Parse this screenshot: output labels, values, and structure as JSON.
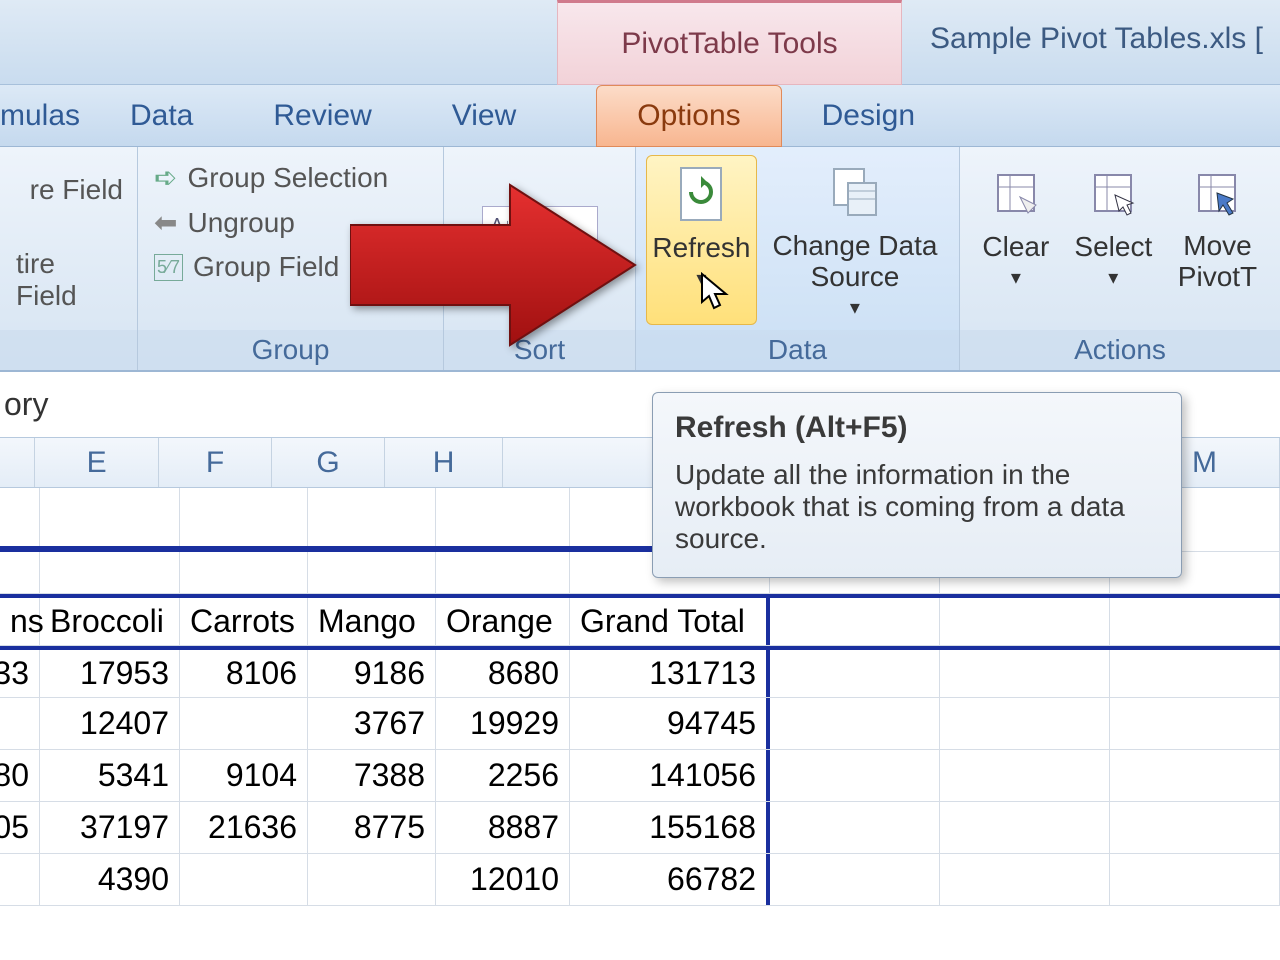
{
  "title": {
    "contextual_tab": "PivotTable Tools",
    "document": "Sample Pivot Tables.xls  ["
  },
  "tabs": {
    "formulas": "mulas",
    "data": "Data",
    "review": "Review",
    "view": "View",
    "options": "Options",
    "design": "Design"
  },
  "ribbon": {
    "active_field": {
      "item1": "re Field",
      "item2": "tire Field"
    },
    "group": {
      "label": "Group",
      "selection": "Group Selection",
      "ungroup": "Ungroup",
      "field": "Group Field"
    },
    "sort": {
      "label": "Sort"
    },
    "data": {
      "label": "Data",
      "refresh": "Refresh",
      "change_source": "Change Data Source"
    },
    "actions": {
      "label": "Actions",
      "clear": "Clear",
      "select": "Select",
      "move": "Move PivotT"
    }
  },
  "formula_bar": "ory",
  "columns": [
    "",
    "E",
    "F",
    "G",
    "H",
    "",
    "",
    "",
    "",
    "M"
  ],
  "pivot": {
    "headers": [
      "ns",
      "Broccoli",
      "Carrots",
      "Mango",
      "Orange",
      "Grand Total"
    ],
    "rows": [
      [
        "33",
        "17953",
        "8106",
        "9186",
        "8680",
        "131713"
      ],
      [
        "",
        "12407",
        "",
        "3767",
        "19929",
        "94745"
      ],
      [
        "80",
        "5341",
        "9104",
        "7388",
        "2256",
        "141056"
      ],
      [
        "05",
        "37197",
        "21636",
        "8775",
        "8887",
        "155168"
      ],
      [
        "",
        "4390",
        "",
        "",
        "12010",
        "66782"
      ]
    ]
  },
  "tooltip": {
    "title": "Refresh (Alt+F5)",
    "body": "Update all the information in the workbook that is coming from a data source."
  }
}
